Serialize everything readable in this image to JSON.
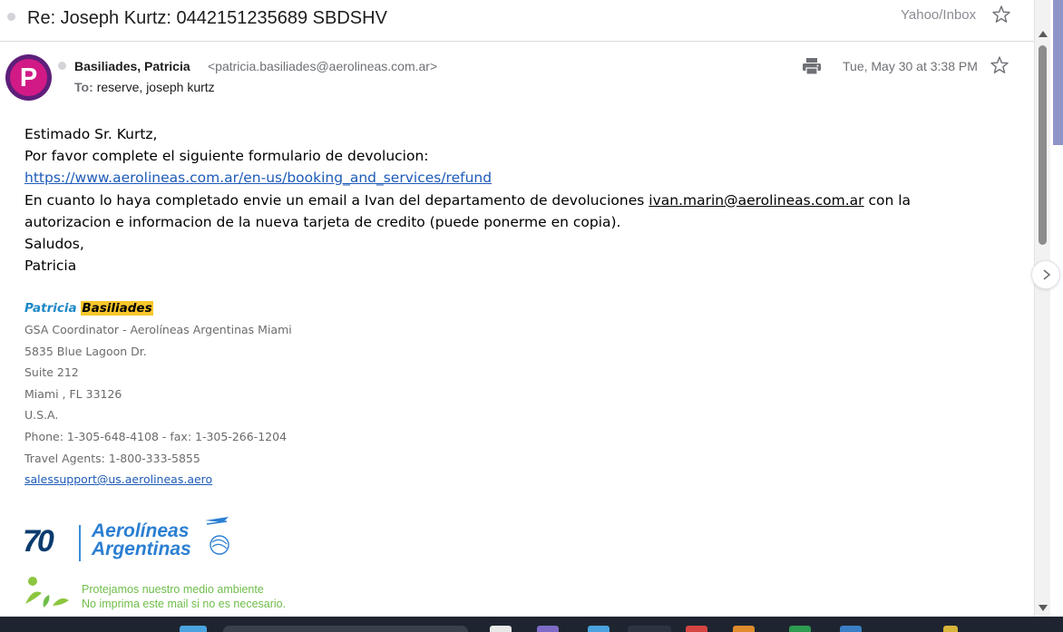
{
  "subject": "Re: Joseph Kurtz: 0442151235689 SBDSHV",
  "folder": "Yahoo/Inbox",
  "sender": {
    "avatar_letter": "P",
    "name": "Basiliades, Patricia",
    "email": "<patricia.basiliades@aerolineas.com.ar>",
    "to_label": "To:",
    "recipients": "reserve,  joseph kurtz",
    "date": "Tue, May 30 at 3:38 PM"
  },
  "body": {
    "greeting": "Estimado Sr. Kurtz,",
    "line1": "Por favor complete el siguiente formulario de devolucion:",
    "refund_link": "https://www.aerolineas.com.ar/en-us/booking_and_services/refund",
    "line2_before": "En cuanto lo haya completado envie un email a Ivan del departamento de devoluciones ",
    "ivan_email": "ivan.marin@aerolineas.com.ar",
    "line2_after": " con la",
    "line3": "autorizacion e informacion de la nueva tarjeta de credito (puede ponerme en copia).",
    "closing": "Saludos,",
    "signoff": "Patricia"
  },
  "signature": {
    "first_name": "Patricia",
    "last_name": "Basiliades",
    "title": "GSA Coordinator - Aerolíneas Argentinas Miami",
    "address1": "5835 Blue Lagoon Dr.",
    "address2": "Suite 212",
    "city": "Miami , FL 33126",
    "country": "U.S.A.",
    "phone": "Phone: 1-305-648-4108 - fax: 1-305-266-1204",
    "agents": "Travel Agents: 1-800-333-5855",
    "email": "salessupport@us.aerolineas.aero"
  },
  "logo": {
    "anniversary": "70",
    "line1": "Aerolíneas",
    "line2": "Argentinas"
  },
  "eco": {
    "line1": "Protejamos nuestro medio ambiente",
    "line2": "No imprima este mail si no es necesario."
  },
  "colors": {
    "link": "#1e5bb8",
    "highlight": "#f7c72b",
    "avatar": "#d11a86",
    "eco_green": "#6fbd4a"
  }
}
